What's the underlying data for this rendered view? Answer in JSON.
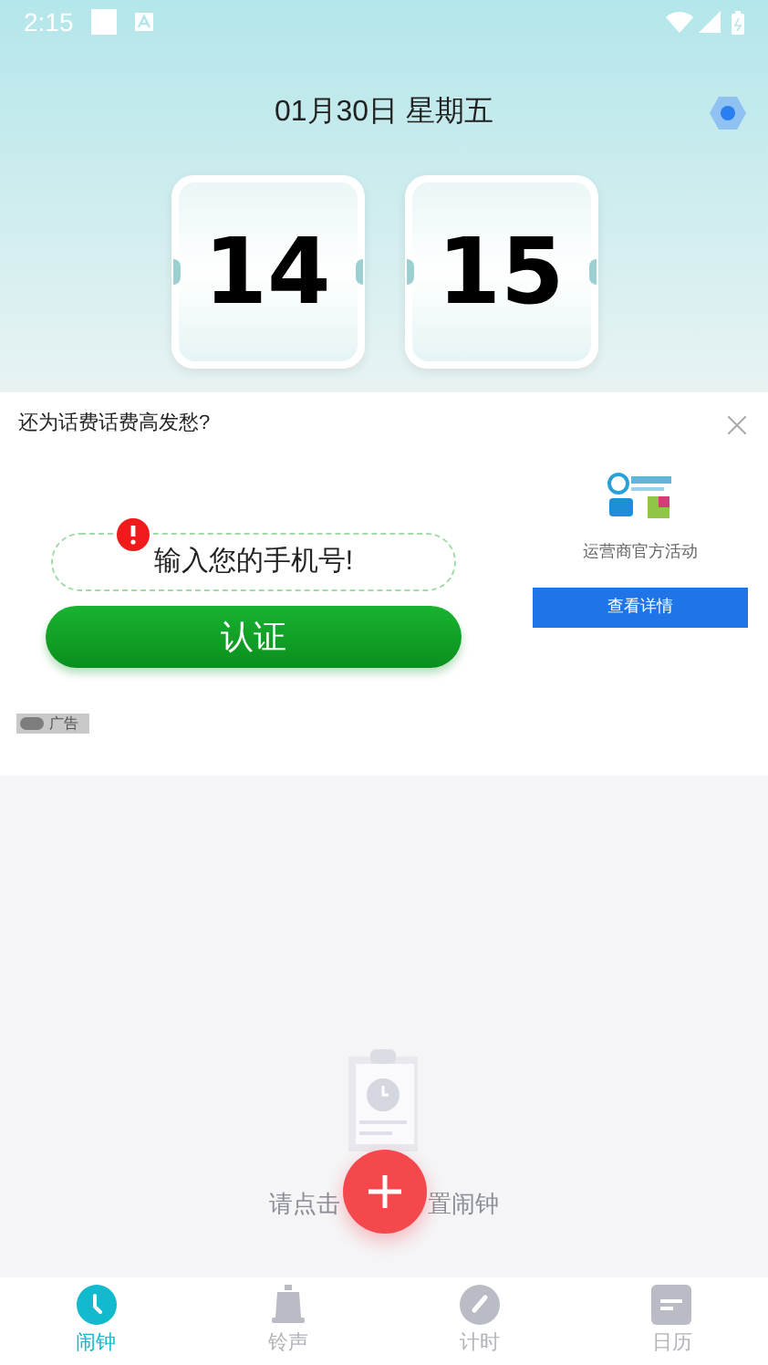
{
  "status_bar": {
    "time": "2:15"
  },
  "header": {
    "date": "01月30日 星期五",
    "hours": "14",
    "minutes": "15"
  },
  "ad": {
    "title": "还为话费话费高发愁?",
    "phone_placeholder": "输入您的手机号!",
    "verify_button": "认证",
    "caption": "运营商官方活动",
    "details_button": "查看详情",
    "badge": "广告"
  },
  "empty_state": {
    "text_before": "请点击",
    "text_after": "置闹钟"
  },
  "tabs": [
    {
      "label": "闹钟",
      "kind": "clock",
      "selected": true
    },
    {
      "label": "铃声",
      "kind": "bell",
      "selected": false
    },
    {
      "label": "计时",
      "kind": "gauge",
      "selected": false
    },
    {
      "label": "日历",
      "kind": "calendar",
      "selected": false
    }
  ]
}
